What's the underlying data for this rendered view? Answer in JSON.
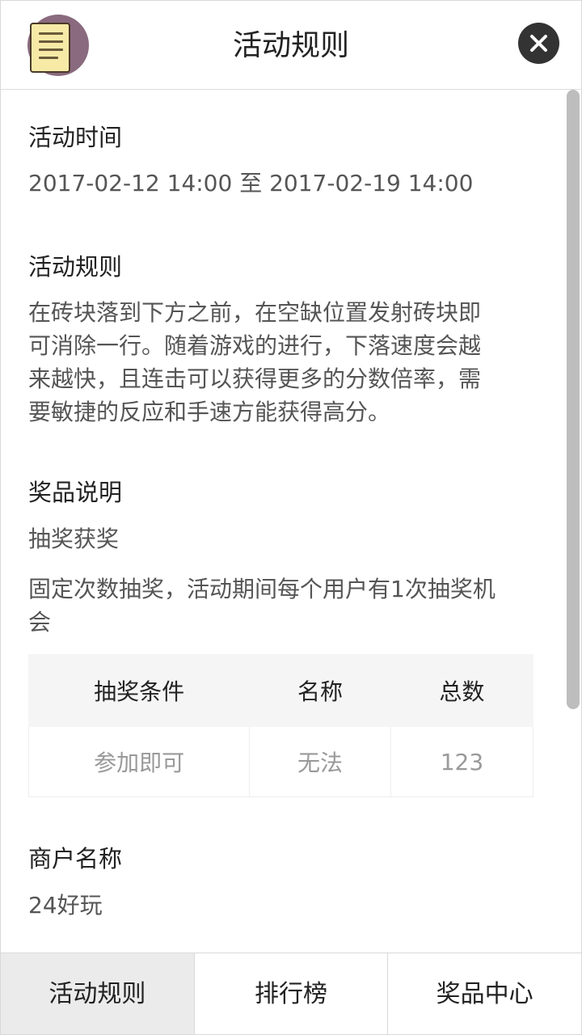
{
  "header": {
    "title": "活动规则",
    "logo_icon": "rules-document-icon",
    "close_icon": "close-icon"
  },
  "sections": {
    "time": {
      "title": "活动时间",
      "value": "2017-02-12 14:00 至 2017-02-19 14:00"
    },
    "rules": {
      "title": "活动规则",
      "lines": [
        "在砖块落到下方之前，在空缺位置发射砖块即",
        "可消除一行。随着游戏的进行，下落速度会越",
        "来越快，且连击可以获得更多的分数倍率，需",
        "要敏捷的反应和手速方能获得高分。"
      ]
    },
    "prizes": {
      "title": "奖品说明",
      "type": "抽奖获奖",
      "desc_lines": [
        "固定次数抽奖，活动期间每个用户有1次抽奖机",
        "会"
      ],
      "table": {
        "headers": [
          "抽奖条件",
          "名称",
          "总数"
        ],
        "rows": [
          [
            "参加即可",
            "无法",
            "123"
          ]
        ]
      }
    },
    "merchant": {
      "title": "商户名称",
      "value": "24好玩"
    }
  },
  "tabs": [
    {
      "label": "活动规则",
      "active": true
    },
    {
      "label": "排行榜",
      "active": false
    },
    {
      "label": "奖品中心",
      "active": false
    }
  ],
  "colors": {
    "active_tab_bg": "#ebebeb",
    "close_button": "#333333",
    "logo_circle": "#8a6a7e",
    "logo_paper": "#f7eaa6"
  }
}
